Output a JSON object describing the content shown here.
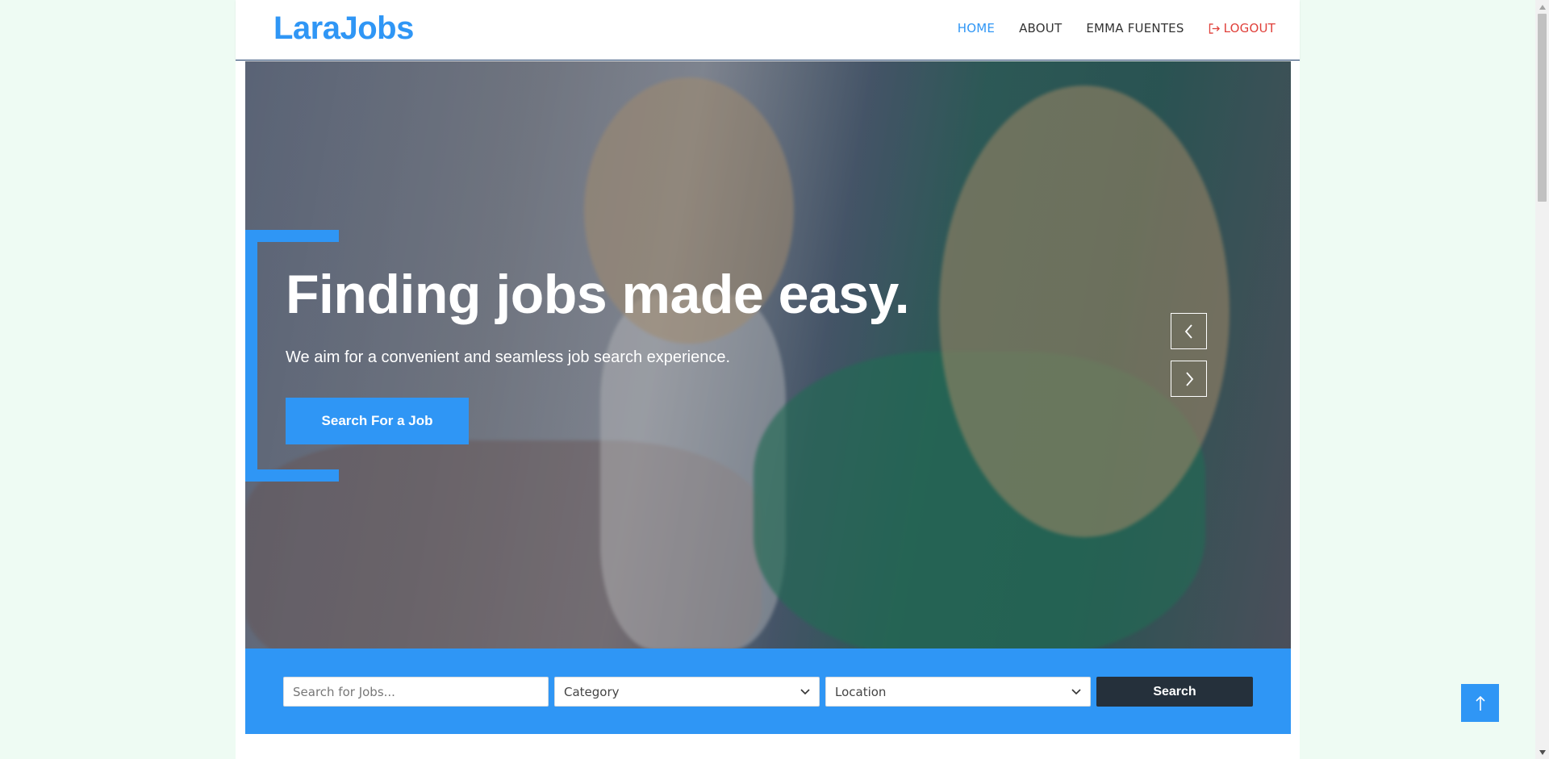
{
  "brand": {
    "logo": "LaraJobs",
    "accent": "#2f96f5"
  },
  "nav": {
    "home": "HOME",
    "about": "ABOUT",
    "user": "EMMA FUENTES",
    "logout": "LOGOUT"
  },
  "hero": {
    "title": "Finding jobs made easy.",
    "subtitle": "We aim for a convenient and seamless job search experience.",
    "cta": "Search For a Job"
  },
  "search": {
    "placeholder": "Search for Jobs...",
    "category": "Category",
    "location": "Location",
    "button": "Search"
  },
  "icons": {
    "logout": "logout-icon",
    "prev": "chevron-left-icon",
    "next": "chevron-right-icon",
    "dropdown": "chevron-down-icon",
    "to_top": "arrow-up-icon"
  }
}
